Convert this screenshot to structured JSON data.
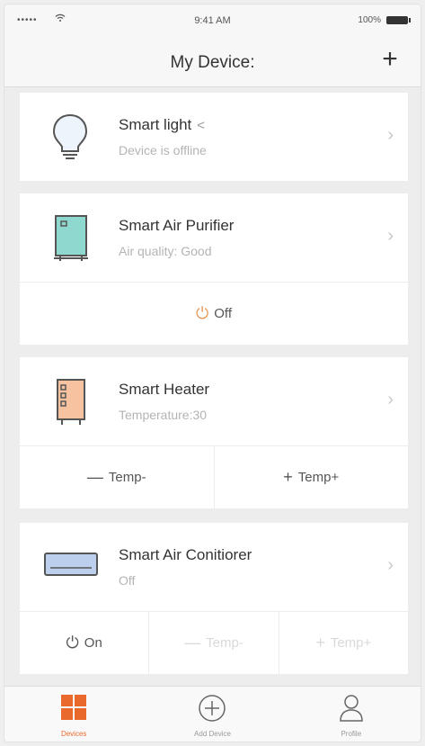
{
  "status_bar": {
    "signal": "•••••",
    "time": "9:41 AM",
    "battery": "100%"
  },
  "nav": {
    "title": "My Device:",
    "add_label": "+"
  },
  "devices": [
    {
      "name": "Smart light",
      "status": "Device is offline",
      "icon": "light-bulb-icon",
      "shared": true
    },
    {
      "name": "Smart Air Purifier",
      "status": "Air quality: Good",
      "icon": "air-purifier-icon",
      "actions": [
        {
          "label": "Off",
          "icon": "power-icon"
        }
      ]
    },
    {
      "name": "Smart Heater",
      "status": "Temperature:30",
      "icon": "heater-icon",
      "actions": [
        {
          "label": "Temp-",
          "icon": "minus-icon"
        },
        {
          "label": "Temp+",
          "icon": "plus-icon"
        }
      ]
    },
    {
      "name": "Smart Air Conitiorer",
      "status": "Off",
      "icon": "air-conditioner-icon",
      "actions": [
        {
          "label": "On",
          "icon": "power-icon"
        },
        {
          "label": "Temp-",
          "icon": "minus-icon",
          "disabled": true
        },
        {
          "label": "Temp+",
          "icon": "plus-icon",
          "disabled": true
        }
      ]
    }
  ],
  "tabs": [
    {
      "label": "Devices",
      "icon": "grid-icon",
      "active": true
    },
    {
      "label": "Add Device",
      "icon": "add-circle-icon"
    },
    {
      "label": "Profile",
      "icon": "person-icon"
    }
  ],
  "colors": {
    "accent": "#e9692c",
    "power": "#e59a5a",
    "purifier": "#8fd8cf",
    "heater": "#f6c29f",
    "ac": "#bcd0ee"
  }
}
